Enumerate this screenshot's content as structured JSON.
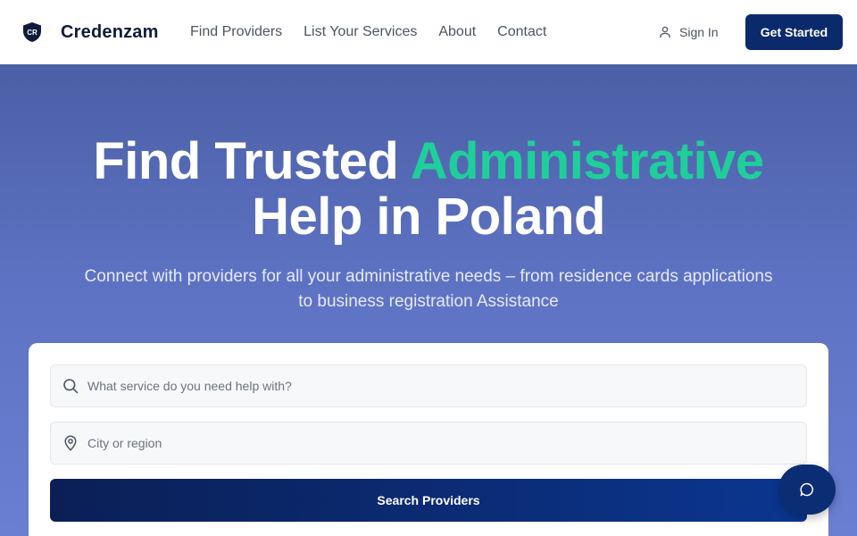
{
  "brand": {
    "name": "Credenzam",
    "logo_text": "CR",
    "logo_icon": "shield-icon"
  },
  "nav": {
    "links": [
      "Find Providers",
      "List Your Services",
      "About",
      "Contact"
    ],
    "sign_in_label": "Sign In",
    "sign_in_icon": "user-icon",
    "cta_label": "Get Started"
  },
  "hero": {
    "title_line1_prefix": "Find Trusted ",
    "title_line1_accent": "Administrative",
    "title_line2": "Help in Poland",
    "subtitle": "Connect with providers for all your administrative needs – from residence cards applications to business registration Assistance"
  },
  "search": {
    "service_placeholder": "What service do you need help with?",
    "service_icon": "search-icon",
    "location_placeholder": "City or region",
    "location_icon": "location-pin-icon",
    "button_label": "Search Providers"
  },
  "chat": {
    "icon": "chat-icon"
  },
  "colors": {
    "brand_navy": "#0b2a6b",
    "accent_green": "#1fcf9a",
    "hero_bg": "#5a6fc0"
  }
}
